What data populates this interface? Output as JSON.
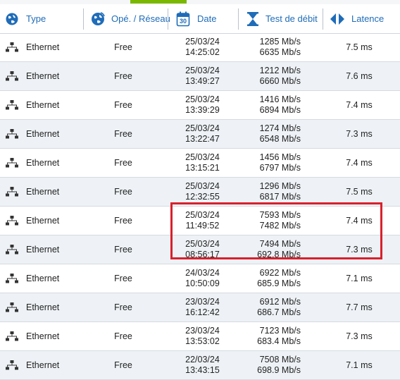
{
  "header": {
    "type_label": "Type",
    "operator_label": "Opé. / Réseau",
    "date_label": "Date",
    "speed_label": "Test de débit",
    "latency_label": "Latence",
    "calendar_day": "30"
  },
  "colors": {
    "accent_blue": "#1f6cb8",
    "highlight_red": "#d9202c",
    "alt_row": "#eef2f6"
  },
  "rows": [
    {
      "type": "Ethernet",
      "operator": "Free",
      "date": "25/03/24",
      "time": "14:25:02",
      "down": "1285 Mb/s",
      "up": "6635 Mb/s",
      "latency": "7.5 ms"
    },
    {
      "type": "Ethernet",
      "operator": "Free",
      "date": "25/03/24",
      "time": "13:49:27",
      "down": "1212 Mb/s",
      "up": "6660 Mb/s",
      "latency": "7.6 ms"
    },
    {
      "type": "Ethernet",
      "operator": "Free",
      "date": "25/03/24",
      "time": "13:39:29",
      "down": "1416 Mb/s",
      "up": "6894 Mb/s",
      "latency": "7.4 ms"
    },
    {
      "type": "Ethernet",
      "operator": "Free",
      "date": "25/03/24",
      "time": "13:22:47",
      "down": "1274 Mb/s",
      "up": "6548 Mb/s",
      "latency": "7.3 ms"
    },
    {
      "type": "Ethernet",
      "operator": "Free",
      "date": "25/03/24",
      "time": "13:15:21",
      "down": "1456 Mb/s",
      "up": "6797 Mb/s",
      "latency": "7.4 ms"
    },
    {
      "type": "Ethernet",
      "operator": "Free",
      "date": "25/03/24",
      "time": "12:32:55",
      "down": "1296 Mb/s",
      "up": "6817 Mb/s",
      "latency": "7.5 ms"
    },
    {
      "type": "Ethernet",
      "operator": "Free",
      "date": "25/03/24",
      "time": "11:49:52",
      "down": "7593 Mb/s",
      "up": "7482 Mb/s",
      "latency": "7.4 ms"
    },
    {
      "type": "Ethernet",
      "operator": "Free",
      "date": "25/03/24",
      "time": "08:56:17",
      "down": "7494 Mb/s",
      "up": "692.8 Mb/s",
      "latency": "7.3 ms"
    },
    {
      "type": "Ethernet",
      "operator": "Free",
      "date": "24/03/24",
      "time": "10:50:09",
      "down": "6922 Mb/s",
      "up": "685.9 Mb/s",
      "latency": "7.1 ms"
    },
    {
      "type": "Ethernet",
      "operator": "Free",
      "date": "23/03/24",
      "time": "16:12:42",
      "down": "6912 Mb/s",
      "up": "686.7 Mb/s",
      "latency": "7.7 ms"
    },
    {
      "type": "Ethernet",
      "operator": "Free",
      "date": "23/03/24",
      "time": "13:53:02",
      "down": "7123 Mb/s",
      "up": "683.4 Mb/s",
      "latency": "7.3 ms"
    },
    {
      "type": "Ethernet",
      "operator": "Free",
      "date": "22/03/24",
      "time": "13:43:15",
      "down": "7508 Mb/s",
      "up": "698.9 Mb/s",
      "latency": "7.1 ms"
    }
  ]
}
